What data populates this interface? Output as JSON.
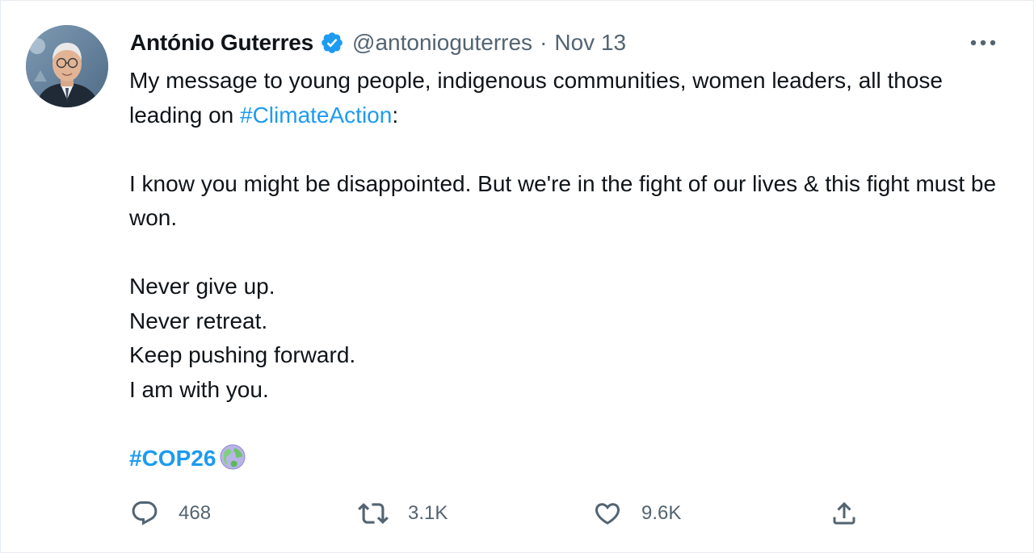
{
  "tweet": {
    "author_name": "António Guterres",
    "handle": "@antonioguterres",
    "separator": "·",
    "date": "Nov 13",
    "verified": true,
    "text": {
      "line1_prefix": "My message to young people, indigenous communities, women leaders, all those leading on ",
      "hashtag_climate": "#ClimateAction",
      "line1_suffix": ":",
      "para2": "I know you might be disappointed. But we're in the fight of our lives & this fight must be won.",
      "line3": "Never give up.",
      "line4": "Never retreat.",
      "line5": "Keep pushing forward.",
      "line6": "I am with you.",
      "hashtag_cop": "#COP26"
    },
    "actions": {
      "reply_count": "468",
      "retweet_count": "3.1K",
      "like_count": "9.6K"
    }
  },
  "colors": {
    "accent": "#1d9bf0",
    "text_primary": "#0f1419",
    "text_secondary": "#536471",
    "border": "#e6ecf0"
  },
  "icons": {
    "verified": "verified-badge-icon",
    "more": "more-horizontal-icon",
    "earth": "globe-earth-emoji-icon",
    "reply": "reply-bubble-icon",
    "retweet": "retweet-icon",
    "like": "heart-icon",
    "share": "share-upload-icon"
  }
}
